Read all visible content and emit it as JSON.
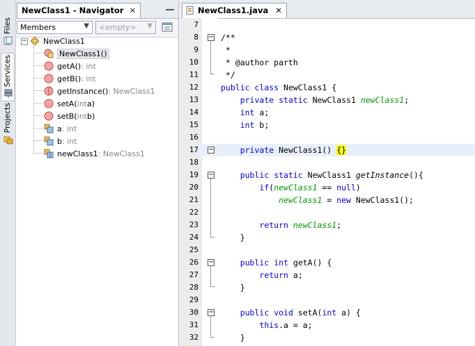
{
  "side_tabs": [
    {
      "label": "Files",
      "icon": "files-icon"
    },
    {
      "label": "Services",
      "icon": "services-icon"
    },
    {
      "label": "Projects",
      "icon": "projects-icon"
    }
  ],
  "navigator": {
    "tab_title": "NewClass1 - Navigator",
    "close_glyph": "✕",
    "filter_value": "Members",
    "scope_value": "<empty>",
    "tree": {
      "root": "NewClass1",
      "members": [
        {
          "name": "NewClass1()",
          "type": "",
          "icon": "constructor-icon"
        },
        {
          "name": "getA()",
          "type": " : int",
          "icon": "method-icon"
        },
        {
          "name": "getB()",
          "type": " : int",
          "icon": "method-icon"
        },
        {
          "name": "getInstance()",
          "type": " : NewClass1",
          "icon": "static-method-icon"
        },
        {
          "name_pre": "setA(",
          "name_type": "int",
          "name_post": " a)",
          "icon": "method-icon"
        },
        {
          "name_pre": "setB(",
          "name_type": "int",
          "name_post": " b)",
          "icon": "method-icon"
        },
        {
          "name": "a",
          "type": " : int",
          "icon": "field-icon"
        },
        {
          "name": "b",
          "type": " : int",
          "icon": "field-icon"
        },
        {
          "name": "newClass1",
          "type": " : NewClass1",
          "icon": "static-field-icon"
        }
      ]
    }
  },
  "editor": {
    "tab_title": "NewClass1.java",
    "close_glyph": "✕",
    "lines": [
      {
        "n": "7"
      },
      {
        "n": "8"
      },
      {
        "n": "9"
      },
      {
        "n": "10"
      },
      {
        "n": "11"
      },
      {
        "n": "12"
      },
      {
        "n": "13"
      },
      {
        "n": "14"
      },
      {
        "n": "15"
      },
      {
        "n": "16"
      },
      {
        "n": "17"
      },
      {
        "n": "18"
      },
      {
        "n": "19"
      },
      {
        "n": "20"
      },
      {
        "n": "21"
      },
      {
        "n": "22"
      },
      {
        "n": "23"
      },
      {
        "n": "24"
      },
      {
        "n": "25"
      },
      {
        "n": "26"
      },
      {
        "n": "27"
      },
      {
        "n": "28"
      },
      {
        "n": "29"
      },
      {
        "n": "30"
      },
      {
        "n": "31"
      },
      {
        "n": "32"
      }
    ],
    "code": {
      "l8": "/**",
      "l9": " *",
      "l10": " * @author parth",
      "l11": " */",
      "public": "public",
      "class": "class",
      "classname": " NewClass1 {",
      "private": "private",
      "static": "static",
      "int": "int",
      "newclass1_type": " NewClass1 ",
      "field_nc1": "newClass1",
      "semi": ";",
      "a_decl": " a;",
      "b_decl": " b;",
      "ctor": " NewClass1() ",
      "braces": "{}",
      "getinstance": "getInstance",
      "parens_brace": "(){",
      "if": "if",
      "paren_open": "(",
      "eq_null_a": " == ",
      "null": "null",
      "close_paren": ")",
      "assign": " = ",
      "new": "new",
      "new_call": " NewClass1();",
      "return": "return",
      "closing_brace": "}",
      "getA": " getA() {",
      "ret_a": " a;",
      "void": "void",
      "setA": " setA(",
      "a_param": " a) {",
      "this": "this",
      "this_a": ".a = a;"
    }
  }
}
